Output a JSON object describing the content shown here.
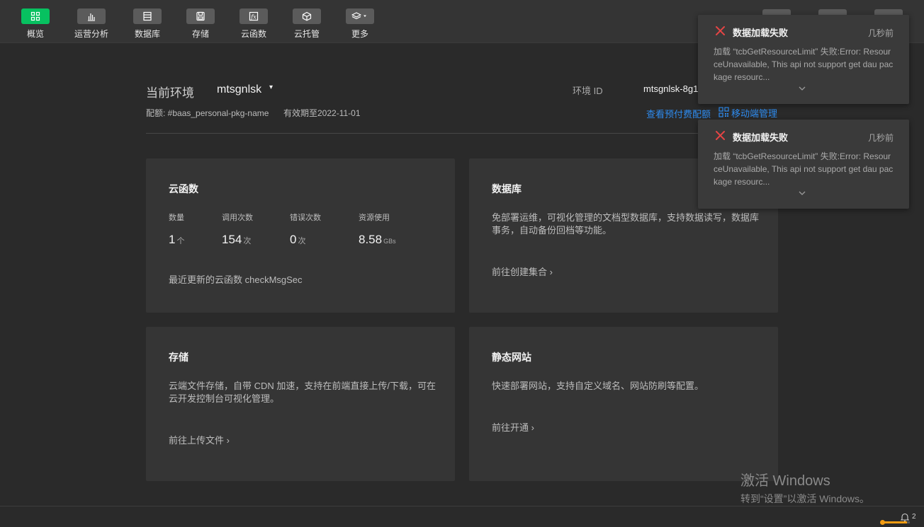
{
  "toolbar": {
    "items": [
      {
        "label": "概览",
        "icon": "grid-icon"
      },
      {
        "label": "运营分析",
        "icon": "bar-chart-icon"
      },
      {
        "label": "数据库",
        "icon": "database-icon"
      },
      {
        "label": "存储",
        "icon": "storage-icon"
      },
      {
        "label": "云函数",
        "icon": "function-icon"
      },
      {
        "label": "云托管",
        "icon": "cube-icon"
      },
      {
        "label": "更多",
        "icon": "layers-icon"
      }
    ],
    "accent_color": "#07c160"
  },
  "env": {
    "label": "当前环境",
    "value": "mtsgnlsk",
    "id_label": "环境 ID",
    "id_value": "mtsgnlsk-8g1",
    "quota": "配额: #baas_personal-pkg-name",
    "expire": "有效期至2022-11-01",
    "link_prepaid": "查看预付费配额",
    "link_mobile": "移动端管理"
  },
  "cards": {
    "functions": {
      "title": "云函数",
      "stats": [
        {
          "label": "数量",
          "value": "1",
          "unit": "个"
        },
        {
          "label": "调用次数",
          "value": "154",
          "unit": "次"
        },
        {
          "label": "错误次数",
          "value": "0",
          "unit": "次"
        },
        {
          "label": "资源使用",
          "value": "8.58",
          "unit": "GBs"
        }
      ],
      "recent": "最近更新的云函数  checkMsgSec"
    },
    "database": {
      "title": "数据库",
      "desc": "免部署运维，可视化管理的文档型数据库，支持数据读写，数据库事务，自动备份回档等功能。",
      "link": "前往创建集合"
    },
    "storage": {
      "title": "存储",
      "desc": "云端文件存储，自带 CDN 加速，支持在前端直接上传/下载，可在云开发控制台可视化管理。",
      "link": "前往上传文件"
    },
    "hosting": {
      "title": "静态网站",
      "desc": "快速部署网站，支持自定义域名、网站防刷等配置。",
      "link": "前往开通"
    }
  },
  "toasts": [
    {
      "title": "数据加载失败",
      "time": "几秒前",
      "message": "加载 “tcbGetResourceLimit” 失败:Error: ResourceUnavailable, This api not support get dau package resourc..."
    },
    {
      "title": "数据加载失败",
      "time": "几秒前",
      "message": "加载 “tcbGetResourceLimit” 失败:Error: ResourceUnavailable, This api not support get dau package resourc..."
    }
  ],
  "watermark": {
    "title": "激活 Windows",
    "subtitle": "转到“设置”以激活 Windows。"
  },
  "statusbar": {
    "notification_count": "2",
    "progress": 0.9
  }
}
